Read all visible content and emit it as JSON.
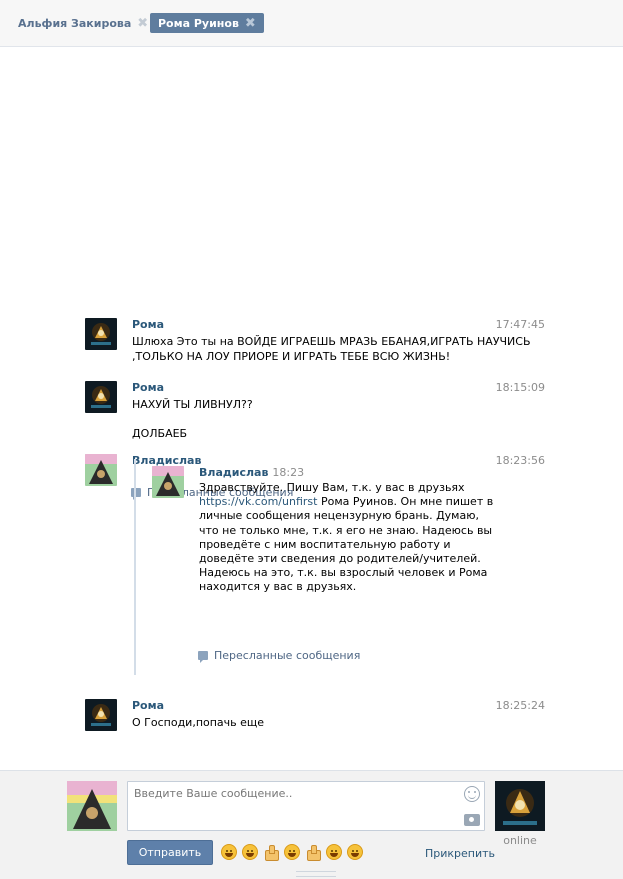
{
  "tabs": [
    {
      "label": "Альфия Закирова",
      "active": false
    },
    {
      "label": "Рома Руинов",
      "active": true
    }
  ],
  "tab_close_glyph": "✖",
  "messages": [
    {
      "author": "Рома",
      "time": "17:47:45",
      "lines": [
        "Шлюха Это ты на ВОЙДЕ ИГРАЕШЬ МРАЗЬ ЕБАНАЯ,ИГРАТЬ НАУЧИСЬ",
        ",ТОЛЬКО НА ЛОУ ПРИОРЕ И ИГРАТЬ ТЕБЕ ВСЮ ЖИЗНЬ!"
      ]
    },
    {
      "author": "Рома",
      "time": "18:15:09",
      "lines": [
        "НАХУЙ ТЫ ЛИВНУЛ??",
        "",
        "ДОЛБАЕБ"
      ]
    },
    {
      "author": "Владислав",
      "time": "18:23:56",
      "forwarded_label": "Пересланные сообщения",
      "forwarded": {
        "author": "Владислав",
        "time": "18:23",
        "text_before_link": "Здравствуйте. Пишу Вам, т.к. у вас в друзьях",
        "link": "https://vk.com/unfirst",
        "text_after_link": " Рома Руинов. Он мне пишет в личные сообщения нецензурную брань. Думаю, что не только мне, т.к. я его не знаю. Надеюсь вы проведёте с ним воспитательную работу и доведёте эти сведения до родителей/учителей. Надеюсь на это, т.к. вы взрослый человек и Рома находится у вас в друзьях.",
        "nested_label": "Пересланные сообщения"
      }
    },
    {
      "author": "Рома",
      "time": "18:25:24",
      "lines": [
        "О Господи,попачь еще"
      ]
    }
  ],
  "composer": {
    "placeholder": "Введите Ваше сообщение..",
    "send_label": "Отправить",
    "attach_label": "Прикрепить",
    "peer_status": "online",
    "emojis": [
      "laughing-tears",
      "tongue-out",
      "thumbs-up",
      "smile",
      "thumbs-up",
      "relieved",
      "grin"
    ]
  },
  "colors": {
    "link": "#2b587a",
    "active_tab": "#5f7d9e",
    "send_button": "#5e80aa"
  }
}
